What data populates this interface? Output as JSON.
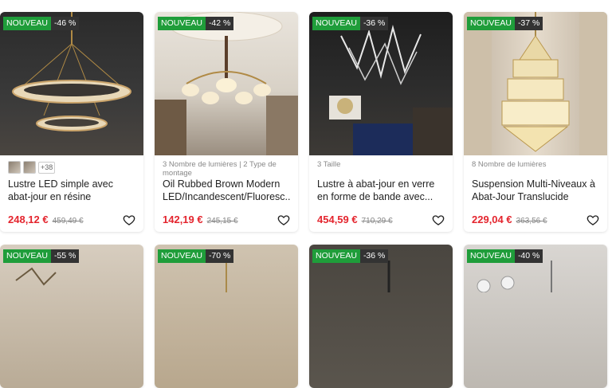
{
  "products": [
    {
      "badge_new": "NOUVEAU",
      "badge_discount": "-46 %",
      "attr": "",
      "more": "+38",
      "title": "Lustre LED simple avec abat-jour en résine translucide...",
      "price": "248,12 €",
      "old_price": "459,49 €"
    },
    {
      "badge_new": "NOUVEAU",
      "badge_discount": "-42 %",
      "attr": "3 Nombre de lumières | 2 Type de montage",
      "more": "",
      "title": "Oil Rubbed Brown Modern LED/Incandescent/Fluoresc...",
      "price": "142,19 €",
      "old_price": "245,15 €"
    },
    {
      "badge_new": "NOUVEAU",
      "badge_discount": "-36 %",
      "attr": "3 Taille",
      "more": "",
      "title": "Lustre à abat-jour en verre en forme de bande avec...",
      "price": "454,59 €",
      "old_price": "710,29 €"
    },
    {
      "badge_new": "NOUVEAU",
      "badge_discount": "-37 %",
      "attr": "8 Nombre de lumières",
      "more": "",
      "title": "Suspension Multi-Niveaux à Abat-Jour Translucide avec...",
      "price": "229,04 €",
      "old_price": "363,56 €"
    },
    {
      "badge_new": "NOUVEAU",
      "badge_discount": "-55 %"
    },
    {
      "badge_new": "NOUVEAU",
      "badge_discount": "-70 %"
    },
    {
      "badge_new": "NOUVEAU",
      "badge_discount": "-36 %"
    },
    {
      "badge_new": "NOUVEAU",
      "badge_discount": "-40 %"
    }
  ],
  "colors": {
    "badge_new": "#1f9d3a",
    "badge_discount": "#333333",
    "price": "#e4252e"
  },
  "icons": {
    "wishlist": "heart-icon"
  }
}
